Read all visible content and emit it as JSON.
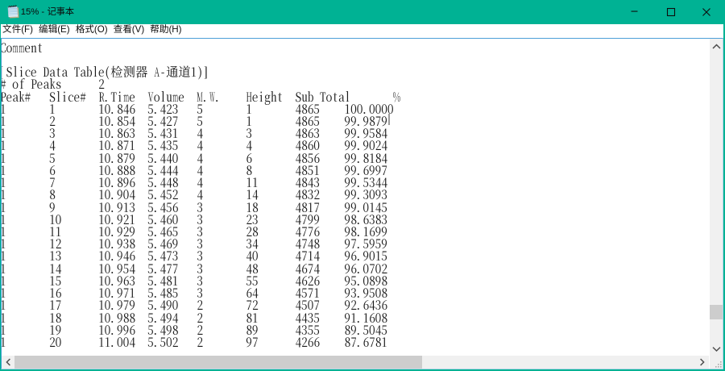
{
  "window": {
    "title": "15% - 记事本",
    "accent_color": "#00b294",
    "title_text_color": "#0c0c0c",
    "icon": "notepad-icon",
    "caption_buttons": {
      "minimize": "minimize",
      "maximize": "maximize",
      "close": "close"
    }
  },
  "menu": {
    "items": [
      {
        "id": "file",
        "label": "文件(F)"
      },
      {
        "id": "edit",
        "label": "编辑(E)"
      },
      {
        "id": "format",
        "label": "格式(O)"
      },
      {
        "id": "view",
        "label": "查看(V)"
      },
      {
        "id": "help",
        "label": "帮助(H)"
      }
    ]
  },
  "editor": {
    "text_color": "#1a1a1a",
    "background": "#ffffff",
    "caret_color": "#9b9b9b",
    "focus_border_color": "#4ea0d8",
    "comment_line": "Comment",
    "table_title": "[Slice Data Table(检测器 A-通道1)]",
    "peaks_label": "# of Peaks",
    "peaks_value": "2",
    "columns": [
      "Peak#",
      "Slice#",
      "R.Time",
      "Volume",
      "M.W.",
      "Height",
      "Sub Total",
      "%"
    ],
    "rows": [
      [
        "1",
        "1",
        "10.846",
        "5.423",
        "5",
        "1",
        "4865",
        "100.0000"
      ],
      [
        "1",
        "2",
        "10.854",
        "5.427",
        "5",
        "1",
        "4865",
        "99.9879"
      ],
      [
        "1",
        "3",
        "10.863",
        "5.431",
        "4",
        "3",
        "4863",
        "99.9584"
      ],
      [
        "1",
        "4",
        "10.871",
        "5.435",
        "4",
        "4",
        "4860",
        "99.9024"
      ],
      [
        "1",
        "5",
        "10.879",
        "5.440",
        "4",
        "6",
        "4856",
        "99.8184"
      ],
      [
        "1",
        "6",
        "10.888",
        "5.444",
        "4",
        "8",
        "4851",
        "99.6997"
      ],
      [
        "1",
        "7",
        "10.896",
        "5.448",
        "4",
        "11",
        "4843",
        "99.5344"
      ],
      [
        "1",
        "8",
        "10.904",
        "5.452",
        "4",
        "14",
        "4832",
        "99.3093"
      ],
      [
        "1",
        "9",
        "10.913",
        "5.456",
        "3",
        "18",
        "4817",
        "99.0145"
      ],
      [
        "1",
        "10",
        "10.921",
        "5.460",
        "3",
        "23",
        "4799",
        "98.6383"
      ],
      [
        "1",
        "11",
        "10.929",
        "5.465",
        "3",
        "28",
        "4776",
        "98.1699"
      ],
      [
        "1",
        "12",
        "10.938",
        "5.469",
        "3",
        "34",
        "4748",
        "97.5959"
      ],
      [
        "1",
        "13",
        "10.946",
        "5.473",
        "3",
        "40",
        "4714",
        "96.9015"
      ],
      [
        "1",
        "14",
        "10.954",
        "5.477",
        "3",
        "48",
        "4674",
        "96.0702"
      ],
      [
        "1",
        "15",
        "10.963",
        "5.481",
        "3",
        "55",
        "4626",
        "95.0898"
      ],
      [
        "1",
        "16",
        "10.971",
        "5.485",
        "3",
        "64",
        "4571",
        "93.9508"
      ],
      [
        "1",
        "17",
        "10.979",
        "5.490",
        "2",
        "72",
        "4507",
        "92.6436"
      ],
      [
        "1",
        "18",
        "10.988",
        "5.494",
        "2",
        "81",
        "4435",
        "91.1608"
      ],
      [
        "1",
        "19",
        "10.996",
        "5.498",
        "2",
        "89",
        "4355",
        "89.5045"
      ],
      [
        "1",
        "20",
        "11.004",
        "5.502",
        "2",
        "97",
        "4266",
        "87.6781"
      ]
    ]
  }
}
